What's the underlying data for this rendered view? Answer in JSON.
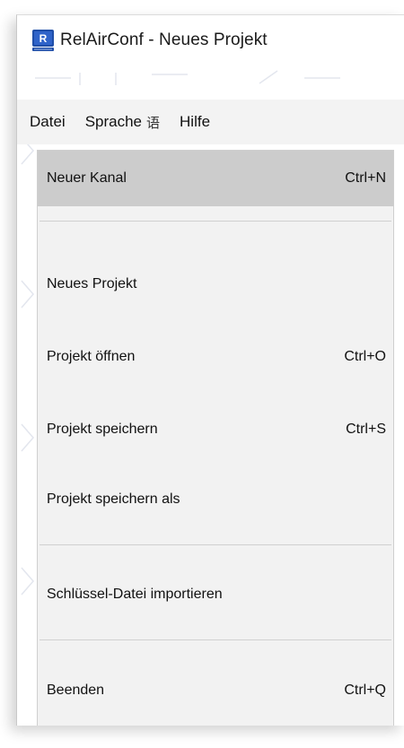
{
  "window": {
    "title": "RelAirConf - Neues Projekt",
    "app_icon": "relairconf-app-icon"
  },
  "menubar": {
    "items": [
      {
        "label": "Datei"
      },
      {
        "label": "Sprache",
        "glyph": "语"
      },
      {
        "label": "Hilfe"
      }
    ]
  },
  "menu": {
    "items": [
      {
        "label": "Neuer Kanal",
        "shortcut": "Ctrl+N",
        "highlighted": true
      },
      {
        "label": "Neues Projekt",
        "shortcut": ""
      },
      {
        "label": "Projekt öffnen",
        "shortcut": "Ctrl+O"
      },
      {
        "label": "Projekt speichern",
        "shortcut": "Ctrl+S"
      },
      {
        "label": "Projekt speichern als",
        "shortcut": ""
      },
      {
        "label": "Schlüssel-Datei importieren",
        "shortcut": ""
      },
      {
        "label": "Beenden",
        "shortcut": "Ctrl+Q"
      }
    ]
  },
  "colors": {
    "menu_background": "#f2f2f2",
    "highlight": "#cccccc",
    "menubar_background": "#f3f3f3",
    "icon_blue": "#1f4ea8"
  }
}
